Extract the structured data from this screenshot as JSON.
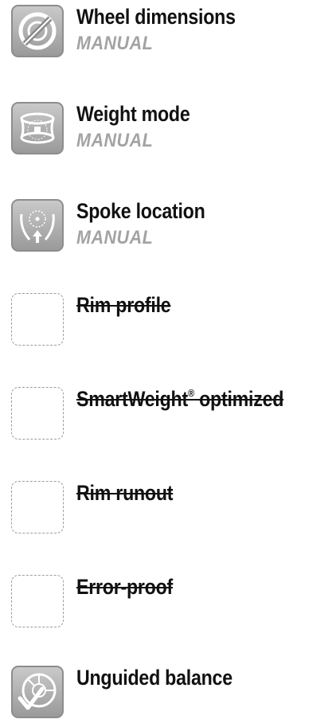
{
  "features": [
    {
      "title": "Wheel dimensions",
      "subtitle": "MANUAL",
      "icon": "wheel-dimensions-icon",
      "enabled": true
    },
    {
      "title": "Weight mode",
      "subtitle": "MANUAL",
      "icon": "weight-mode-icon",
      "enabled": true
    },
    {
      "title": "Spoke location",
      "subtitle": "MANUAL",
      "icon": "spoke-location-icon",
      "enabled": true
    },
    {
      "title": "Rim profile",
      "icon": "empty-icon",
      "enabled": false
    },
    {
      "title": "SmartWeight",
      "title_mark": "®",
      "title_suffix": " optimized",
      "icon": "empty-icon",
      "enabled": false
    },
    {
      "title": "Rim runout",
      "icon": "empty-icon",
      "enabled": false
    },
    {
      "title": "Error-proof",
      "icon": "empty-icon",
      "enabled": false
    },
    {
      "title": "Unguided balance",
      "icon": "unguided-balance-icon",
      "enabled": true
    }
  ]
}
